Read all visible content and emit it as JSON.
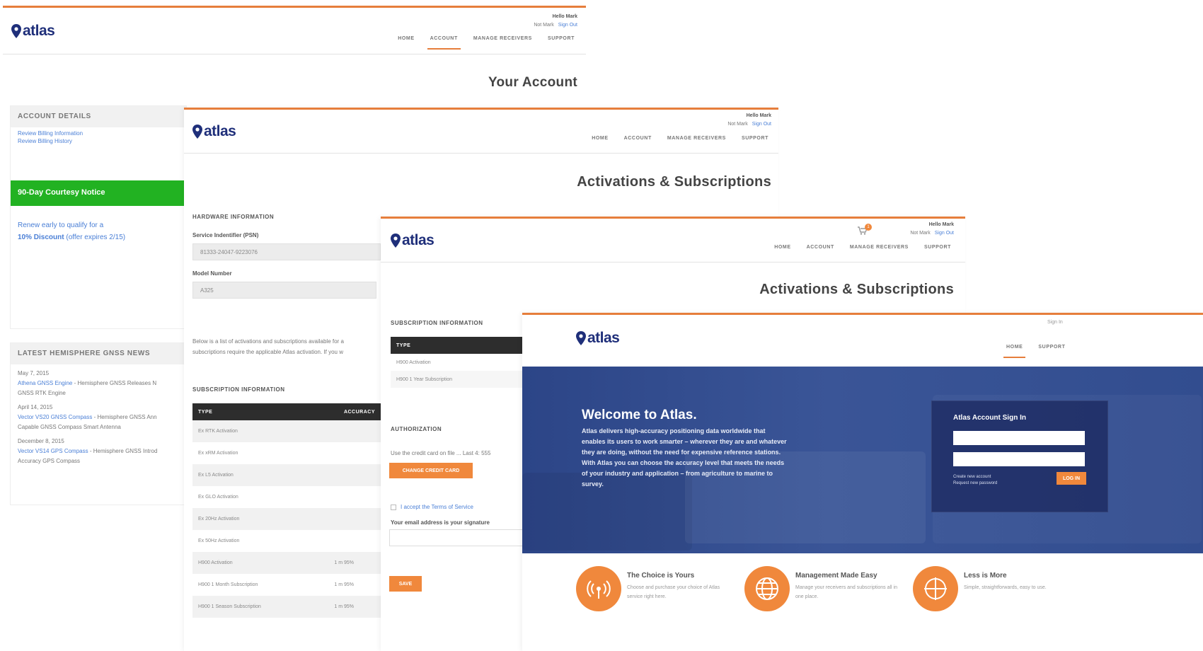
{
  "colors": {
    "brand_blue": "#1f2f7a",
    "accent_orange": "#e67e3c",
    "link_blue": "#4a7fd6",
    "green_notice": "#22b222",
    "hero_blue": "#34508f"
  },
  "brand": {
    "name": "atlas"
  },
  "header": {
    "user_name": "Hello Mark",
    "user_link": "Not Mark",
    "signout": "Sign Out",
    "nav": [
      "HOME",
      "ACCOUNT",
      "MANAGE RECEIVERS",
      "SUPPORT"
    ]
  },
  "screen1": {
    "title": "Your Account",
    "account_details": {
      "heading": "ACCOUNT DETAILS",
      "links": [
        "Review Billing Information",
        "Review Billing History"
      ]
    },
    "notice": {
      "label": "90-Day Courtesy Notice",
      "line1": "Renew early to qualify for a",
      "discount": "10% Discount",
      "expiry": "(offer expires 2/15)"
    },
    "news": {
      "heading": "LATEST HEMISPHERE GNSS NEWS",
      "items": [
        {
          "date": "May 7, 2015",
          "link": "Athena GNSS Engine",
          "text": "- Hemisphere GNSS Releases N",
          "text2": "GNSS RTK Engine"
        },
        {
          "date": "April 14, 2015",
          "link": "Vector VS20 GNSS Compass",
          "text": "- Hemisphere GNSS Ann",
          "text2": "Capable GNSS Compass Smart Antenna"
        },
        {
          "date": "December 8, 2015",
          "link": "Vector VS14 GPS Compass",
          "text": "- Hemisphere GNSS Introd",
          "text2": "Accuracy GPS Compass"
        }
      ]
    }
  },
  "screen2": {
    "title": "Activations & Subscriptions",
    "hardware_heading": "HARDWARE INFORMATION",
    "psn_label": "Service Indentifier (PSN)",
    "psn_value": "81333-24047-9223076",
    "model_label": "Model Number",
    "model_value": "A325",
    "para1": "Below is a list of activations and subscriptions available for a",
    "para2": "subscriptions require the applicable Atlas activation. If you w",
    "subscription_heading": "SUBSCRIPTION INFORMATION",
    "table_headers": [
      "TYPE",
      "ACCURACY"
    ],
    "rows": [
      {
        "type": "Ex RTK Activation",
        "acc": ""
      },
      {
        "type": "Ex xRM Activation",
        "acc": ""
      },
      {
        "type": "Ex L5 Activation",
        "acc": ""
      },
      {
        "type": "Ex GLO Activation",
        "acc": ""
      },
      {
        "type": "Ex 20Hz Activation",
        "acc": ""
      },
      {
        "type": "Ex 50Hz Activation",
        "acc": ""
      },
      {
        "type": "H900 Activation",
        "acc": "1 m 95%"
      },
      {
        "type": "H900 1 Month Subscription",
        "acc": "1 m 95%"
      },
      {
        "type": "H900 1 Season Subscription",
        "acc": "1 m 95%"
      }
    ]
  },
  "screen3": {
    "title": "Activations & Subscriptions",
    "subscription_heading": "SUBSCRIPTION INFORMATION",
    "table_header": "TYPE",
    "rows": [
      "H900 Activation",
      "H900 1 Year Subscription"
    ],
    "authorization_heading": "AUTHORIZATION",
    "card_text": "Use the credit card on file ... Last 4: 555",
    "change_card_btn": "CHANGE CREDIT CARD",
    "terms_text": "I accept the Terms of Service",
    "email_label": "Your email address is your signature",
    "save_btn": "SAVE",
    "cart_count": "1"
  },
  "screen4": {
    "signin_link": "Sign In",
    "nav": [
      "HOME",
      "SUPPORT"
    ],
    "hero_title": "Welcome to Atlas.",
    "hero_text": "Atlas delivers high-accuracy positioning data worldwide that enables its users to work smarter – wherever they are and whatever they are doing, without the need for expensive reference stations. With Atlas you can choose the accuracy level that meets the needs of your industry and application – from agriculture to marine to survey.",
    "signin_title": "Atlas Account Sign In",
    "create_account": "Create new account",
    "request_password": "Request new password",
    "login_btn": "LOG IN",
    "features": [
      {
        "title": "The Choice is Yours",
        "desc": "Choose and purchase your choice of Atlas service right here."
      },
      {
        "title": "Management Made Easy",
        "desc": "Manage your receivers and subscriptions all in one place."
      },
      {
        "title": "Less is More",
        "desc": "Simple, straightforwards, easy to use."
      }
    ]
  }
}
